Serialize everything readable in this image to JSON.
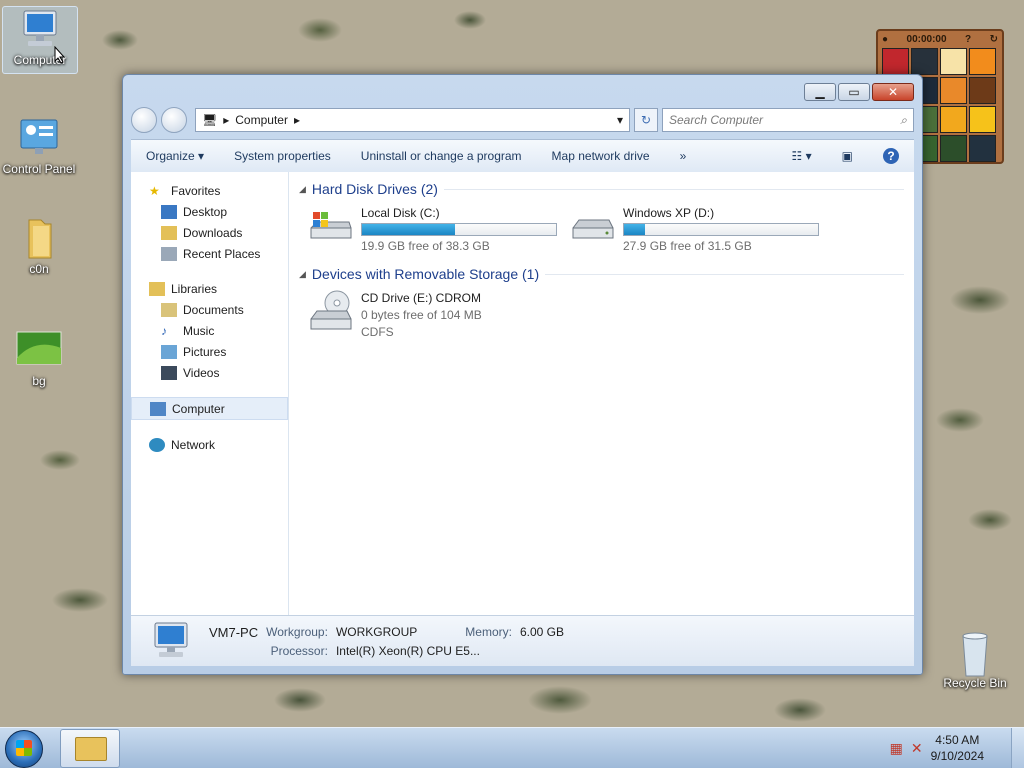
{
  "desktop": {
    "icons": [
      {
        "label": "Computer",
        "icon": "computer-icon"
      },
      {
        "label": "Control Panel",
        "icon": "control-panel-icon"
      },
      {
        "label": "c0n",
        "icon": "folder-icon"
      },
      {
        "label": "bg",
        "icon": "image-icon"
      },
      {
        "label": "Recycle Bin",
        "icon": "recycle-bin-icon"
      }
    ]
  },
  "gadget": {
    "timer": "00:00:00"
  },
  "window": {
    "breadcrumb": [
      "Computer"
    ],
    "search_placeholder": "Search Computer",
    "toolbar": {
      "organize": "Organize",
      "system_properties": "System properties",
      "uninstall": "Uninstall or change a program",
      "map_drive": "Map network drive",
      "more": "»"
    },
    "navpane": {
      "favorites": "Favorites",
      "favorites_items": [
        "Desktop",
        "Downloads",
        "Recent Places"
      ],
      "libraries": "Libraries",
      "libraries_items": [
        "Documents",
        "Music",
        "Pictures",
        "Videos"
      ],
      "computer": "Computer",
      "network": "Network"
    },
    "groups": {
      "hard_disk": "Hard Disk Drives (2)",
      "removable": "Devices with Removable Storage (1)"
    },
    "drives": [
      {
        "name": "Local Disk (C:)",
        "free": "19.9 GB free of 38.3 GB",
        "used_fraction": 0.48
      },
      {
        "name": "Windows XP (D:)",
        "free": "27.9 GB free of 31.5 GB",
        "used_fraction": 0.11
      }
    ],
    "removable": [
      {
        "name": "CD Drive (E:) CDROM",
        "free": "0 bytes free of 104 MB",
        "fs": "CDFS"
      }
    ],
    "details": {
      "pc_name": "VM7-PC",
      "workgroup_label": "Workgroup:",
      "workgroup": "WORKGROUP",
      "memory_label": "Memory:",
      "memory": "6.00 GB",
      "processor_label": "Processor:",
      "processor": "Intel(R) Xeon(R) CPU E5..."
    }
  },
  "taskbar": {
    "time": "4:50 AM",
    "date": "9/10/2024"
  },
  "colors": {
    "accent": "#1e3f8c",
    "bar_fill": "#1b86c4"
  }
}
